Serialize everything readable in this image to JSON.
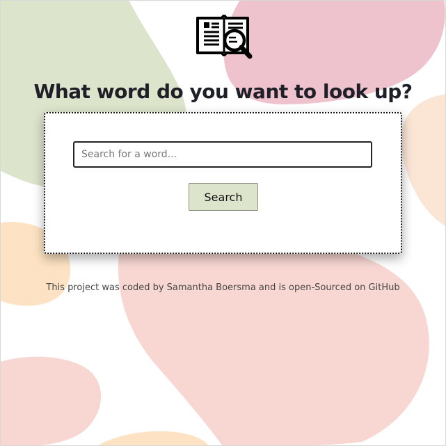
{
  "header": {
    "logo_icon": "book-magnifier-icon",
    "title": "What word do you want to look up?"
  },
  "search": {
    "placeholder": "Search for a word...",
    "value": "",
    "button_label": "Search"
  },
  "footer": {
    "prefix": "This project was coded by ",
    "author_link": "Samantha Boersma",
    "middle": " and is ",
    "repo_link": "open-Sourced on GitHub"
  },
  "colors": {
    "blob_green": "#dde4cc",
    "blob_pink": "#efc3ce",
    "blob_peach": "#fbe6d6",
    "blob_salmon": "#f8d7d2",
    "blob_orange": "#fde3c3",
    "button_bg": "#dde4cc"
  }
}
